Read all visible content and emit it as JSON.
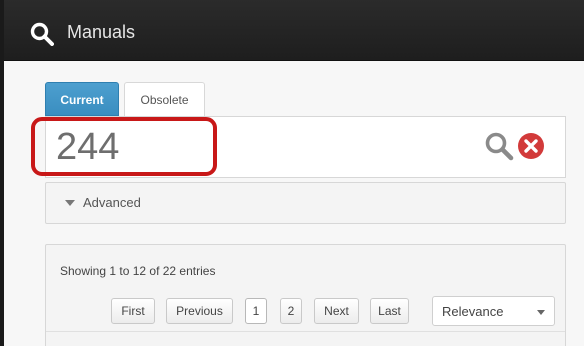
{
  "header": {
    "title": "Manuals",
    "icon": "search-icon"
  },
  "tabs": [
    {
      "label": "Current",
      "active": true
    },
    {
      "label": "Obsolete",
      "active": false
    }
  ],
  "search": {
    "value": "244",
    "search_icon": "search-icon",
    "clear_icon": "clear-icon",
    "highlight_color": "#c81818"
  },
  "advanced": {
    "label": "Advanced",
    "icon": "caret-down-icon"
  },
  "results": {
    "info": "Showing 1 to 12 of 22 entries",
    "pagination": {
      "first": "First",
      "previous": "Previous",
      "pages": [
        "1",
        "2"
      ],
      "current_page": "1",
      "next": "Next",
      "last": "Last"
    },
    "sort": {
      "selected": "Relevance"
    }
  },
  "colors": {
    "accent": "#3a8ec0",
    "topbar": "#222222"
  }
}
